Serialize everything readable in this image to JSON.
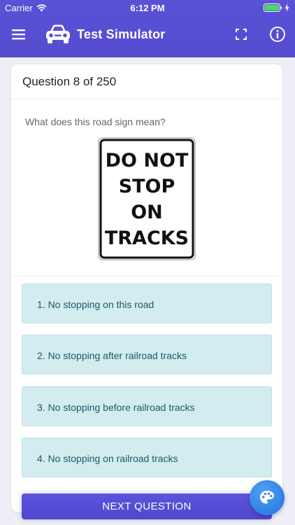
{
  "status_bar": {
    "carrier": "Carrier",
    "time": "6:12 PM"
  },
  "header": {
    "title": "Test Simulator",
    "menu_icon": "hamburger-menu-icon",
    "app_icon": "car-icon",
    "fullscreen_icon": "fullscreen-icon",
    "info_icon": "info-icon"
  },
  "question": {
    "counter": "Question 8 of 250",
    "prompt": "What does this road sign mean?",
    "sign_lines": [
      "DO NOT",
      "STOP",
      "ON",
      "TRACKS"
    ]
  },
  "answers": [
    {
      "label": "1. No stopping on this road"
    },
    {
      "label": "2. No stopping after railroad tracks"
    },
    {
      "label": "3. No stopping before railroad tracks"
    },
    {
      "label": "4. No stopping on railroad tracks"
    }
  ],
  "next_button": "NEXT QUESTION",
  "fab_icon": "palette-icon",
  "colors": {
    "brand": "#5a52d6",
    "answer_bg": "#d2ecf0",
    "answer_text": "#1b5a66",
    "fab": "#2f7fe6"
  }
}
